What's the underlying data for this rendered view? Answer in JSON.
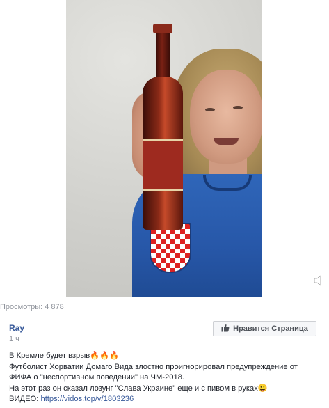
{
  "post": {
    "views": "Просмотры: 4 878",
    "author": "Ray",
    "time": "1 ч",
    "like_page_label": "Нравится Страница",
    "lines": [
      "В Кремле будет взрыв🔥🔥🔥",
      "Футболист Хорватии Домаго Вида злостно проигнорировал предупреждение от",
      "ФИФА о \"неспортивном поведении\" на ЧМ-2018.",
      "На этот раз он сказал лозунг \"Слава Украине\" еще и с пивом в руках😀"
    ],
    "video_prefix": "ВИДЕО: ",
    "video_link": "https://vidos.top/v/1803236"
  },
  "icons": {
    "volume": "volume-icon",
    "like": "thumbs-up-icon"
  }
}
